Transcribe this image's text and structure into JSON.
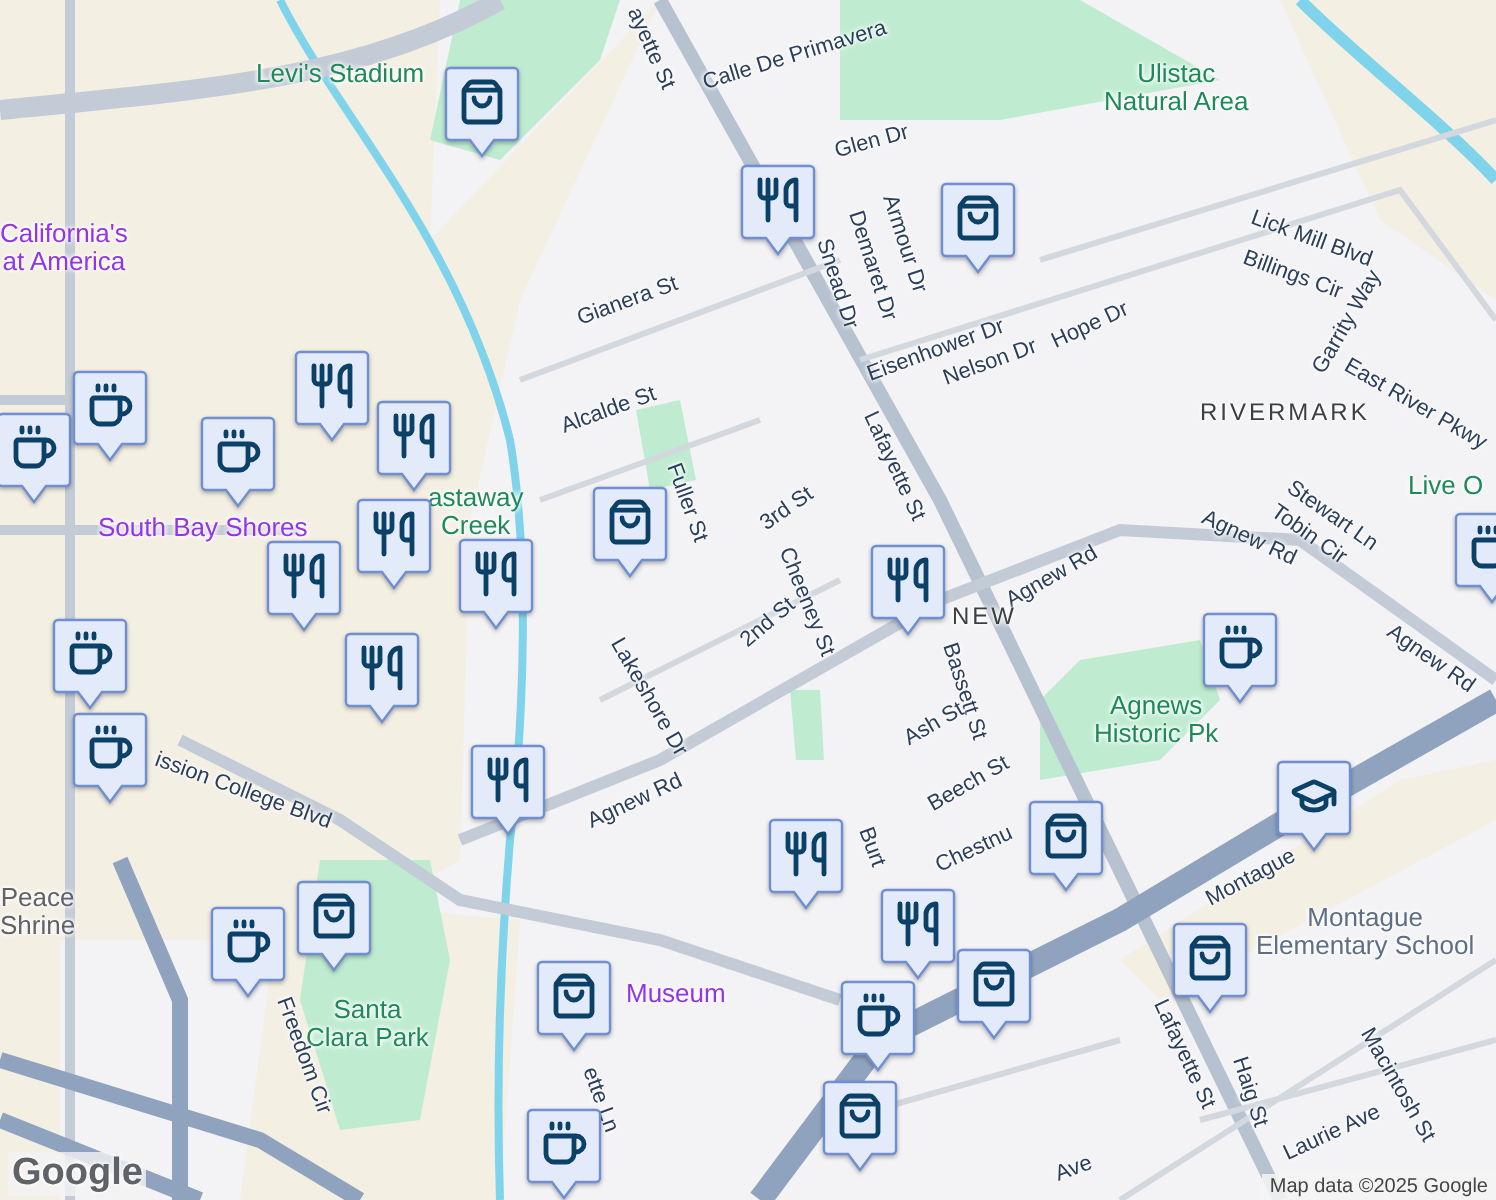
{
  "labels": [
    {
      "kind": "poi-green",
      "text": "Levi's Stadium"
    },
    {
      "kind": "street",
      "text": "Calle De Primavera"
    },
    {
      "kind": "street",
      "text": "ayette St"
    },
    {
      "kind": "poi-purple",
      "text": "California's\nat America"
    },
    {
      "kind": "park",
      "text": "Ulistac\nNatural Area"
    },
    {
      "kind": "street",
      "text": "Glen Dr"
    },
    {
      "kind": "street",
      "text": "Gianera St"
    },
    {
      "kind": "street",
      "text": "Alcalde St"
    },
    {
      "kind": "street",
      "text": "Snead Dr"
    },
    {
      "kind": "street",
      "text": "Demaret Dr"
    },
    {
      "kind": "street",
      "text": "Armour Dr"
    },
    {
      "kind": "street",
      "text": "Eisenhower Dr"
    },
    {
      "kind": "street",
      "text": "Nelson Dr"
    },
    {
      "kind": "street",
      "text": "Hope Dr"
    },
    {
      "kind": "street",
      "text": "Lick Mill Blvd"
    },
    {
      "kind": "street",
      "text": "Billings Cir"
    },
    {
      "kind": "street",
      "text": "Garrity Way"
    },
    {
      "kind": "street",
      "text": "East River Pkwy"
    },
    {
      "kind": "district",
      "text": "RIVERMARK"
    },
    {
      "kind": "poi-purple",
      "text": "South Bay Shores"
    },
    {
      "kind": "park",
      "text": "astaway\nCreek"
    },
    {
      "kind": "street",
      "text": "Fuller St"
    },
    {
      "kind": "street",
      "text": "3rd St"
    },
    {
      "kind": "street",
      "text": "Lafayette St"
    },
    {
      "kind": "street",
      "text": "Stewart Ln"
    },
    {
      "kind": "street",
      "text": "Tobin Cir"
    },
    {
      "kind": "street",
      "text": "Agnew Rd"
    },
    {
      "kind": "street",
      "text": "Agnew Rd"
    },
    {
      "kind": "street",
      "text": "Agnew Rd"
    },
    {
      "kind": "street",
      "text": "2nd St"
    },
    {
      "kind": "street",
      "text": "Cheeney St"
    },
    {
      "kind": "district",
      "text": "NEW"
    },
    {
      "kind": "street",
      "text": "Lakeshore Dr"
    },
    {
      "kind": "street",
      "text": "Bassett St"
    },
    {
      "kind": "park",
      "text": "Agnews\nHistoric Pk"
    },
    {
      "kind": "street",
      "text": "Ash St"
    },
    {
      "kind": "street",
      "text": "Agnew Rd"
    },
    {
      "kind": "street",
      "text": "Beech St"
    },
    {
      "kind": "street",
      "text": "ission College Blvd"
    },
    {
      "kind": "poi-grey",
      "text": "Peace\nShrine"
    },
    {
      "kind": "street",
      "text": "Chestnu"
    },
    {
      "kind": "street",
      "text": "Montague"
    },
    {
      "kind": "school",
      "text": "Montague\nElementary School"
    },
    {
      "kind": "street",
      "text": "Burt"
    },
    {
      "kind": "park",
      "text": "Santa\nClara Park"
    },
    {
      "kind": "street",
      "text": "Freedom Cir"
    },
    {
      "kind": "poi-purple",
      "text": "Museum"
    },
    {
      "kind": "street",
      "text": "ette Ln"
    },
    {
      "kind": "street",
      "text": "Lafayette St"
    },
    {
      "kind": "street",
      "text": "Haig St"
    },
    {
      "kind": "street",
      "text": "Laurie Ave"
    },
    {
      "kind": "street",
      "text": "Macintosh St"
    },
    {
      "kind": "street",
      "text": "Ave"
    },
    {
      "kind": "park",
      "text": "Live O"
    }
  ],
  "markers": [
    {
      "kind": "cafe"
    },
    {
      "kind": "cafe"
    },
    {
      "kind": "cafe"
    },
    {
      "kind": "cafe"
    },
    {
      "kind": "cafe"
    },
    {
      "kind": "cafe"
    },
    {
      "kind": "cafe"
    },
    {
      "kind": "cafe"
    },
    {
      "kind": "cafe"
    },
    {
      "kind": "cafe"
    },
    {
      "kind": "restaurant"
    },
    {
      "kind": "restaurant"
    },
    {
      "kind": "restaurant"
    },
    {
      "kind": "restaurant"
    },
    {
      "kind": "restaurant"
    },
    {
      "kind": "restaurant"
    },
    {
      "kind": "restaurant"
    },
    {
      "kind": "restaurant"
    },
    {
      "kind": "restaurant"
    },
    {
      "kind": "restaurant"
    },
    {
      "kind": "restaurant"
    },
    {
      "kind": "shop"
    },
    {
      "kind": "shop"
    },
    {
      "kind": "shop"
    },
    {
      "kind": "shop"
    },
    {
      "kind": "shop"
    },
    {
      "kind": "shop"
    },
    {
      "kind": "shop"
    },
    {
      "kind": "shop"
    },
    {
      "kind": "shop"
    },
    {
      "kind": "school"
    }
  ],
  "logo": "Google",
  "attribution": "Map data ©2025 Google"
}
